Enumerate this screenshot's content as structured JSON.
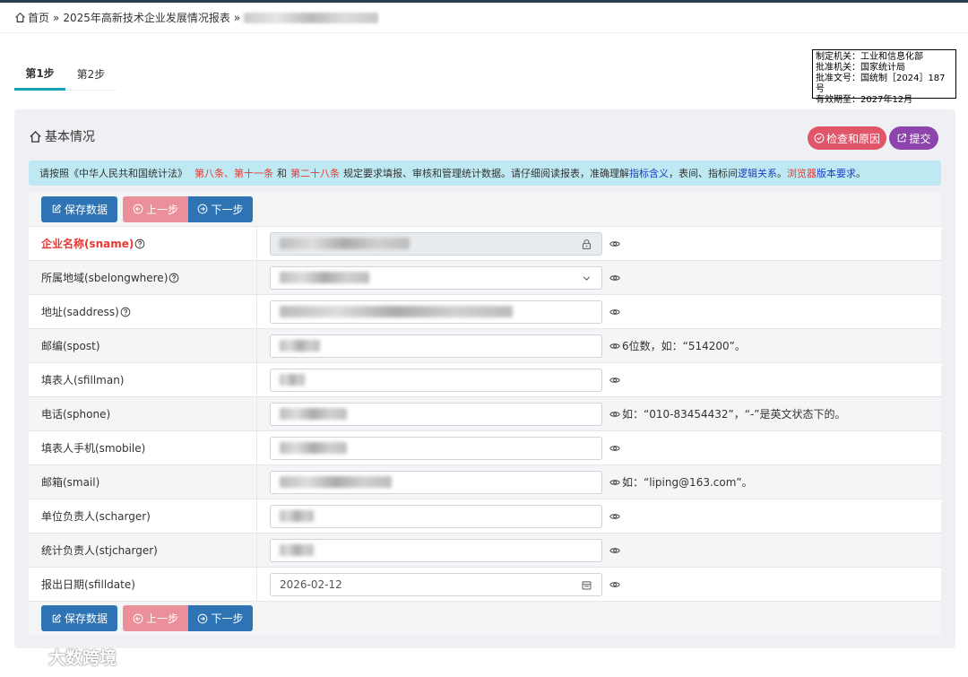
{
  "breadcrumb": {
    "home": "首页",
    "separator": "»",
    "report": "2025年高新技术企业发展情况报表"
  },
  "tabs": [
    {
      "label": "第1步",
      "active": true
    },
    {
      "label": "第2步",
      "active": false
    }
  ],
  "approval": {
    "line1": "制定机关：工业和信息化部",
    "line2": "批准机关：国家统计局",
    "line3": "批准文号：国统制［2024］187号",
    "line4": "有效期至：2027年12月"
  },
  "panel": {
    "title": "基本情况",
    "check_label": "检查和原因",
    "submit_label": "提交"
  },
  "notice": {
    "p1": "请按照《中华人民共和国统计法》",
    "r1": "第八条、第十一条",
    "p2": "和",
    "r2": "第二十八条",
    "p3": "规定要求填报、审核和管理统计数据。请仔细阅读报表，准确理解",
    "b1": "指标含义",
    "p4": "，表间、指标间",
    "b2": "逻辑关系",
    "p5": "。",
    "r3": "浏览器",
    "b3": "版本要求",
    "p6": "。"
  },
  "buttons": {
    "save": "保存数据",
    "prev": "上一步",
    "next": "下一步"
  },
  "fields": [
    {
      "label": "企业名称(sname)",
      "required": true,
      "help": true,
      "hint": ""
    },
    {
      "label": "所属地域(sbelongwhere)",
      "required": false,
      "help": true,
      "hint": ""
    },
    {
      "label": "地址(saddress)",
      "required": false,
      "help": true,
      "hint": ""
    },
    {
      "label": "邮编(spost)",
      "required": false,
      "help": false,
      "hint": "6位数，如：“514200”。"
    },
    {
      "label": "填表人(sfillman)",
      "required": false,
      "help": false,
      "hint": ""
    },
    {
      "label": "电话(sphone)",
      "required": false,
      "help": false,
      "hint": "如：“010-83454432”，“-”是英文状态下的。"
    },
    {
      "label": "填表人手机(smobile)",
      "required": false,
      "help": false,
      "hint": ""
    },
    {
      "label": "邮箱(smail)",
      "required": false,
      "help": false,
      "hint": "如：“liping@163.com”。"
    },
    {
      "label": "单位负责人(scharger)",
      "required": false,
      "help": false,
      "hint": ""
    },
    {
      "label": "统计负责人(stjcharger)",
      "required": false,
      "help": false,
      "hint": ""
    },
    {
      "label": "报出日期(sfilldate)",
      "required": false,
      "help": false,
      "hint": "",
      "value": "2026-02-12"
    }
  ],
  "watermark": "大数跨境"
}
